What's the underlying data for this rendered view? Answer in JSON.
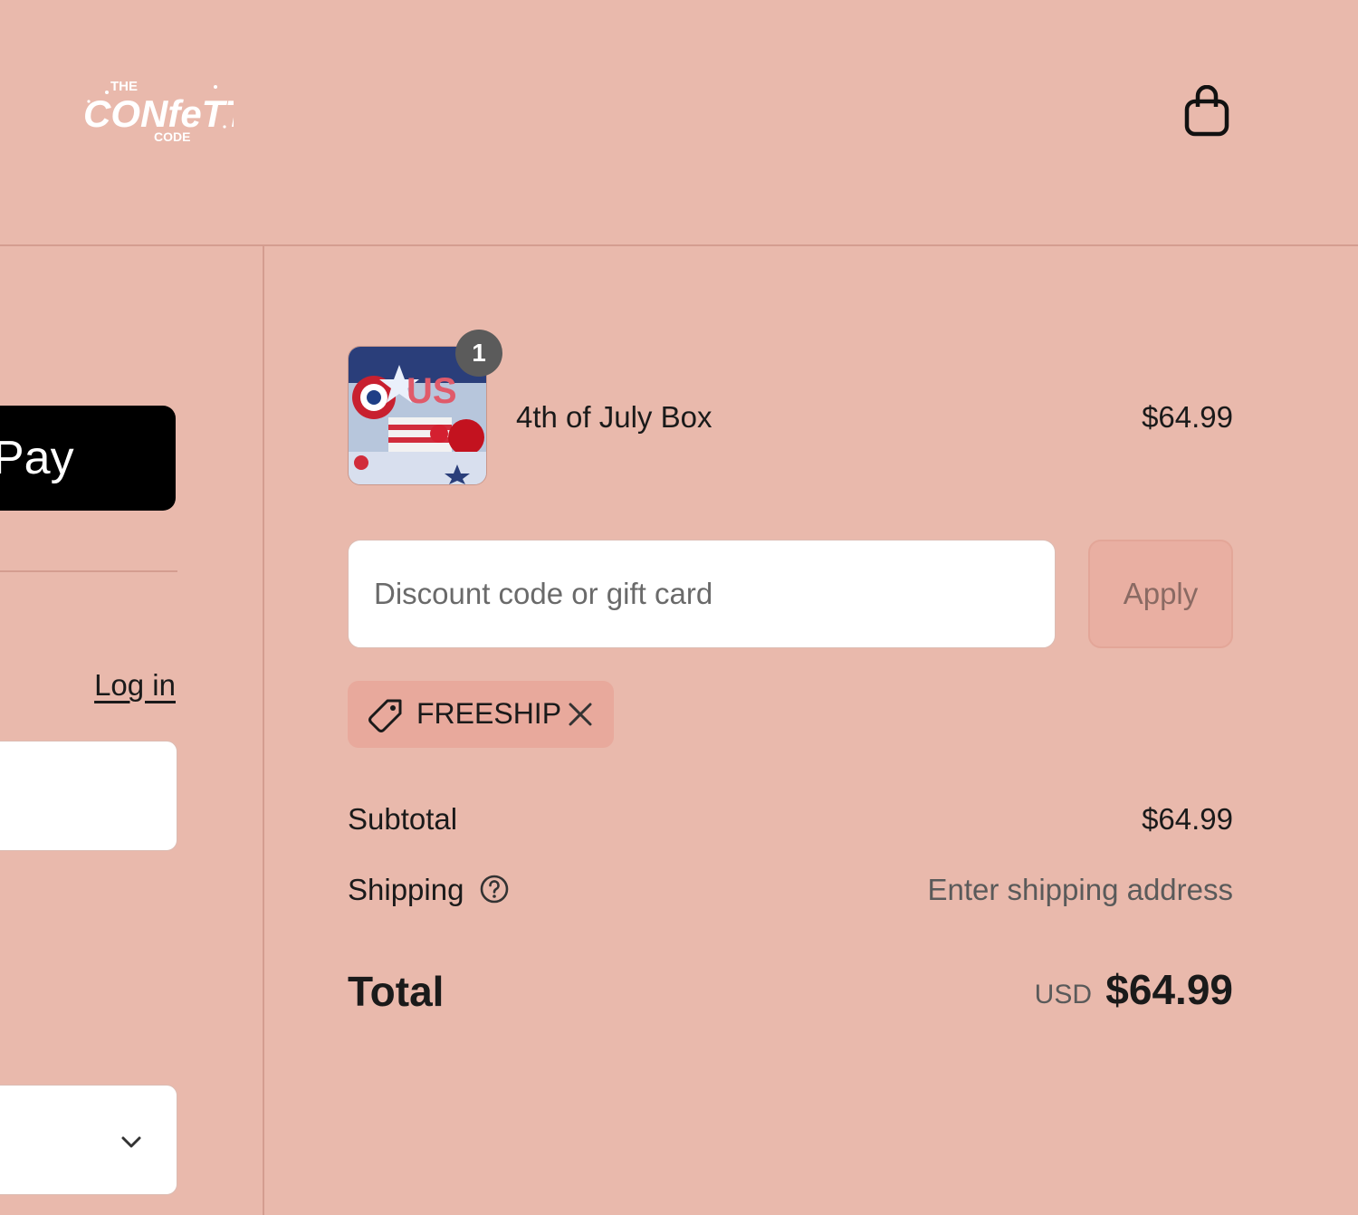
{
  "header": {
    "logo_text": "THE CONFETTI CODE",
    "cart_icon": "shopping-bag-icon"
  },
  "left": {
    "express_pay_label": "Pay",
    "login_link": "Log in",
    "country_select_icon": "chevron-down-icon"
  },
  "order": {
    "items": [
      {
        "name": "4th of July Box",
        "price": "$64.99",
        "quantity": "1"
      }
    ],
    "discount": {
      "placeholder": "Discount code or gift card",
      "value": "",
      "apply_label": "Apply",
      "applied_code": "FREESHIP",
      "tag_icon": "tag-icon",
      "remove_icon": "close-icon"
    },
    "subtotal_label": "Subtotal",
    "subtotal_value": "$64.99",
    "shipping_label": "Shipping",
    "shipping_help_icon": "question-circle-icon",
    "shipping_value": "Enter shipping address",
    "total_label": "Total",
    "total_currency": "USD",
    "total_value": "$64.99"
  },
  "colors": {
    "background": "#e9b9ac",
    "divider": "#d49d90",
    "tag_background": "#e8a99c",
    "apply_background": "#e9afa2"
  }
}
